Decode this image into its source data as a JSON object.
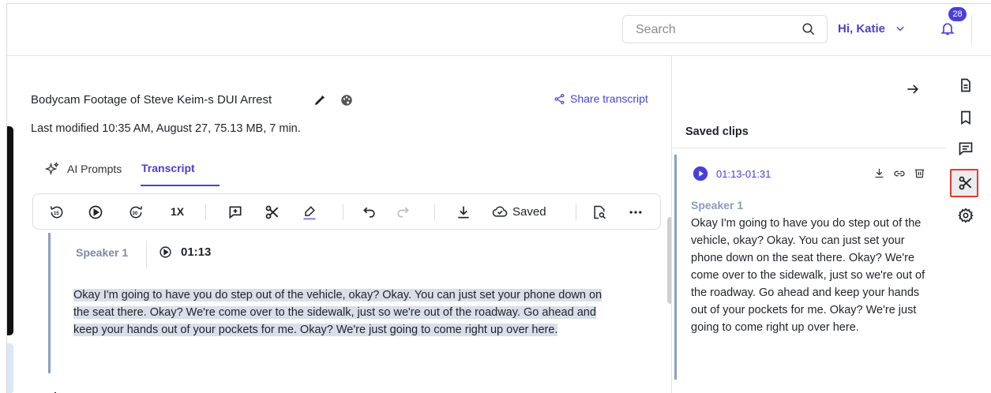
{
  "header": {
    "search_placeholder": "Search",
    "greeting": "Hi, Katie",
    "notification_count": "28"
  },
  "document": {
    "title": "Bodycam Footage of Steve Keim-s DUI Arrest",
    "meta": "Last modified 10:35 AM, August 27, 75.13 MB, 7 min.",
    "share_label": "Share transcript"
  },
  "tabs": [
    {
      "label": "AI Prompts",
      "active": false
    },
    {
      "label": "Transcript",
      "active": true
    }
  ],
  "toolbar": {
    "speed": "1X",
    "saved_label": "Saved",
    "icons": [
      "rewind-15-icon",
      "play-icon",
      "forward-30-icon",
      "add-comment-icon",
      "scissors-icon",
      "highlighter-icon",
      "undo-icon",
      "redo-icon",
      "download-icon",
      "cloud-check-icon",
      "find-in-page-icon",
      "more-icon"
    ]
  },
  "segment": {
    "speaker": "Speaker 1",
    "time": "01:13",
    "text": "Okay I'm going to have you do step out of the vehicle, okay? Okay. You can just set your phone down on the seat there. Okay? We're come over to the sidewalk, just so we're out of the roadway. Go ahead and keep your hands out of your pockets for me. Okay? We're just going to come right up over here."
  },
  "panel": {
    "title": "Saved clips",
    "clip": {
      "range": "01:13-01:31",
      "speaker": "Speaker 1",
      "text": "Okay I'm going to have you do step out of the vehicle, okay? Okay. You can just set your phone down on the seat there. Okay? We're come over to the sidewalk, just so we're out of the roadway. Go ahead and keep your hands out of your pockets for me. Okay? We're just going to come right up over here."
    }
  },
  "rail": {
    "items": [
      "document-icon",
      "bookmark-icon",
      "comments-icon",
      "scissors-icon",
      "settings-icon"
    ],
    "active": "scissors-icon"
  },
  "colors": {
    "accent": "#4a3fd8",
    "highlight": "#d9dee9",
    "active_border": "#e53935"
  }
}
